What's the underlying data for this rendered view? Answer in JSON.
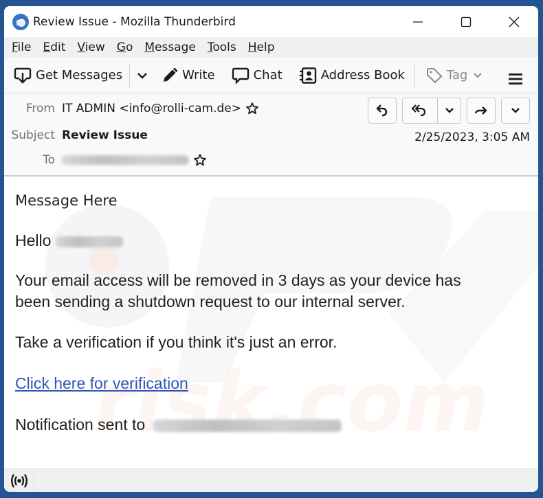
{
  "window": {
    "title": "Review Issue - Mozilla Thunderbird",
    "controls": [
      "minimize",
      "maximize",
      "close"
    ]
  },
  "menubar": {
    "items": [
      {
        "label": "File",
        "accel": "F",
        "rest": "ile"
      },
      {
        "label": "Edit",
        "accel": "E",
        "rest": "dit"
      },
      {
        "label": "View",
        "accel": "V",
        "rest": "iew"
      },
      {
        "label": "Go",
        "accel": "G",
        "rest": "o"
      },
      {
        "label": "Message",
        "accel": "M",
        "rest": "essage"
      },
      {
        "label": "Tools",
        "accel": "T",
        "rest": "ools"
      },
      {
        "label": "Help",
        "accel": "H",
        "rest": "elp"
      }
    ]
  },
  "toolbar": {
    "get_messages": "Get Messages",
    "write": "Write",
    "chat": "Chat",
    "address_book": "Address Book",
    "tag": "Tag"
  },
  "header": {
    "from_label": "From",
    "from_value": "IT ADMIN <info@rolli-cam.de>",
    "subject_label": "Subject",
    "subject_value": "Review Issue",
    "to_label": "To",
    "to_value_redacted": true,
    "date": "2/25/2023, 3:05 AM",
    "actions": [
      "reply",
      "reply-all",
      "reply-all-dropdown",
      "forward",
      "more"
    ]
  },
  "message": {
    "heading": "Message Here",
    "greeting": "Hello",
    "paragraph1_line1": "Your email access will be removed in 3 days as your device has",
    "paragraph1_line2": "been sending a shutdown request to our internal server.",
    "paragraph2": "Take a verification if you think it's just an error.",
    "link": "Click here for verification",
    "notification": "Notification sent to"
  },
  "colors": {
    "desktop": "#245592",
    "link": "#2b58b8",
    "label_gray": "#6f6f73"
  },
  "watermark": "PC risk.com"
}
